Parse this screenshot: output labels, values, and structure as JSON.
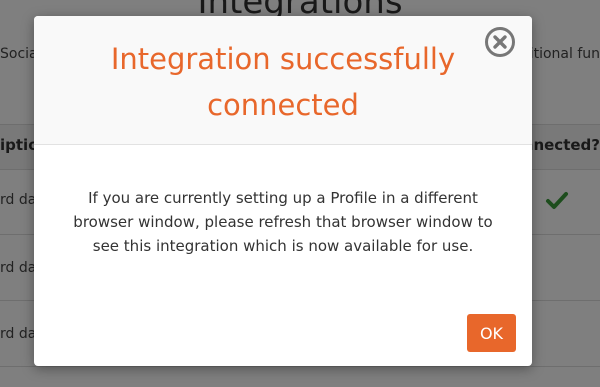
{
  "background_page": {
    "title": "Integrations",
    "subtitle_left": "Social",
    "subtitle_right": "itional fun",
    "table": {
      "header_left": "iption",
      "header_right": "nnected?",
      "rows": [
        {
          "label": "rd da",
          "connected": true
        },
        {
          "label": "rd da",
          "connected": false
        },
        {
          "label": "rd da",
          "connected": false
        }
      ]
    }
  },
  "modal": {
    "title": "Integration successfully connected",
    "body": "If you are currently setting up a Profile in a different browser window, please refresh that browser window to see this integration which is now available for use.",
    "ok_label": "OK",
    "close_icon": "close-circle-icon"
  },
  "colors": {
    "accent": "#e8672b",
    "check": "#3a9a3a",
    "overlay": "rgba(0,0,0,0.5)"
  }
}
